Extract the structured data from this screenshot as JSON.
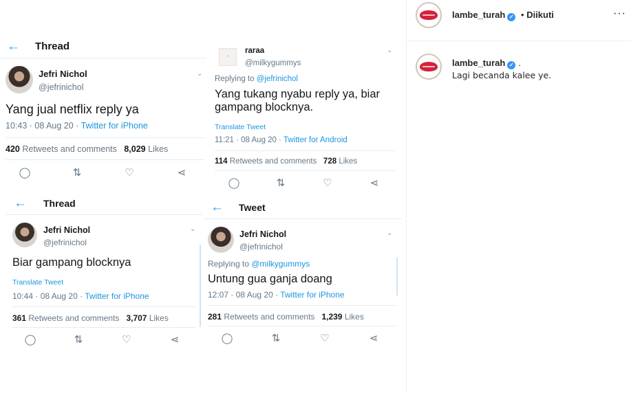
{
  "post_image": {
    "thread1": {
      "header_title": "Thread",
      "author_name": "Jefri Nichol",
      "author_handle": "@jefrinichol",
      "text": "Yang jual netflix reply ya",
      "time": "10:43 · 08 Aug 20 · ",
      "source": "Twitter for iPhone",
      "retweets": "420",
      "retweets_label": "Retweets and comments",
      "likes": "8,029",
      "likes_label": "Likes"
    },
    "reply_raraa": {
      "author_name": "raraa",
      "author_handle": "@milkygummys",
      "replying_prefix": "Replying to ",
      "replying_to": "@jefrinichol",
      "text_line1": "Yang tukang nyabu reply ya, biar",
      "text_line2": "gampang blocknya.",
      "translate": "Translate Tweet",
      "time": "11:21 · 08 Aug 20 · ",
      "source": "Twitter for Android",
      "retweets": "114",
      "retweets_label": "Retweets and comments",
      "likes": "728",
      "likes_label": "Likes"
    },
    "thread2": {
      "header_title": "Thread",
      "author_name": "Jefri Nichol",
      "author_handle": "@jefrinichol",
      "text": "Biar gampang blocknya",
      "translate": "Translate Tweet",
      "time": "10:44 · 08 Aug 20 · ",
      "source": "Twitter for iPhone",
      "retweets": "361",
      "retweets_label": "Retweets and comments",
      "likes": "3,707",
      "likes_label": "Likes"
    },
    "tweet4": {
      "header_title": "Tweet",
      "author_name": "Jefri Nichol",
      "author_handle": "@jefrinichol",
      "replying_prefix": "Replying to ",
      "replying_to": "@milkygummys",
      "text": "Untung gua ganja doang",
      "time": "12:07 · 08 Aug 20 · ",
      "source": "Twitter for iPhone",
      "retweets": "281",
      "retweets_label": "Retweets and comments",
      "likes": "1,239",
      "likes_label": "Likes"
    }
  },
  "pane": {
    "header": {
      "username": "lambe_turah",
      "dot": "•",
      "follow_state": "Diikuti",
      "more": "···"
    },
    "caption": {
      "username": "lambe_turah",
      "trailing": ".",
      "text": "Lagi becanda kalee ye."
    }
  },
  "colors": {
    "twitter_blue": "#1b95e0",
    "grey_text": "#657786",
    "verified_blue": "#3897f0",
    "lips_red": "#d4223a"
  }
}
